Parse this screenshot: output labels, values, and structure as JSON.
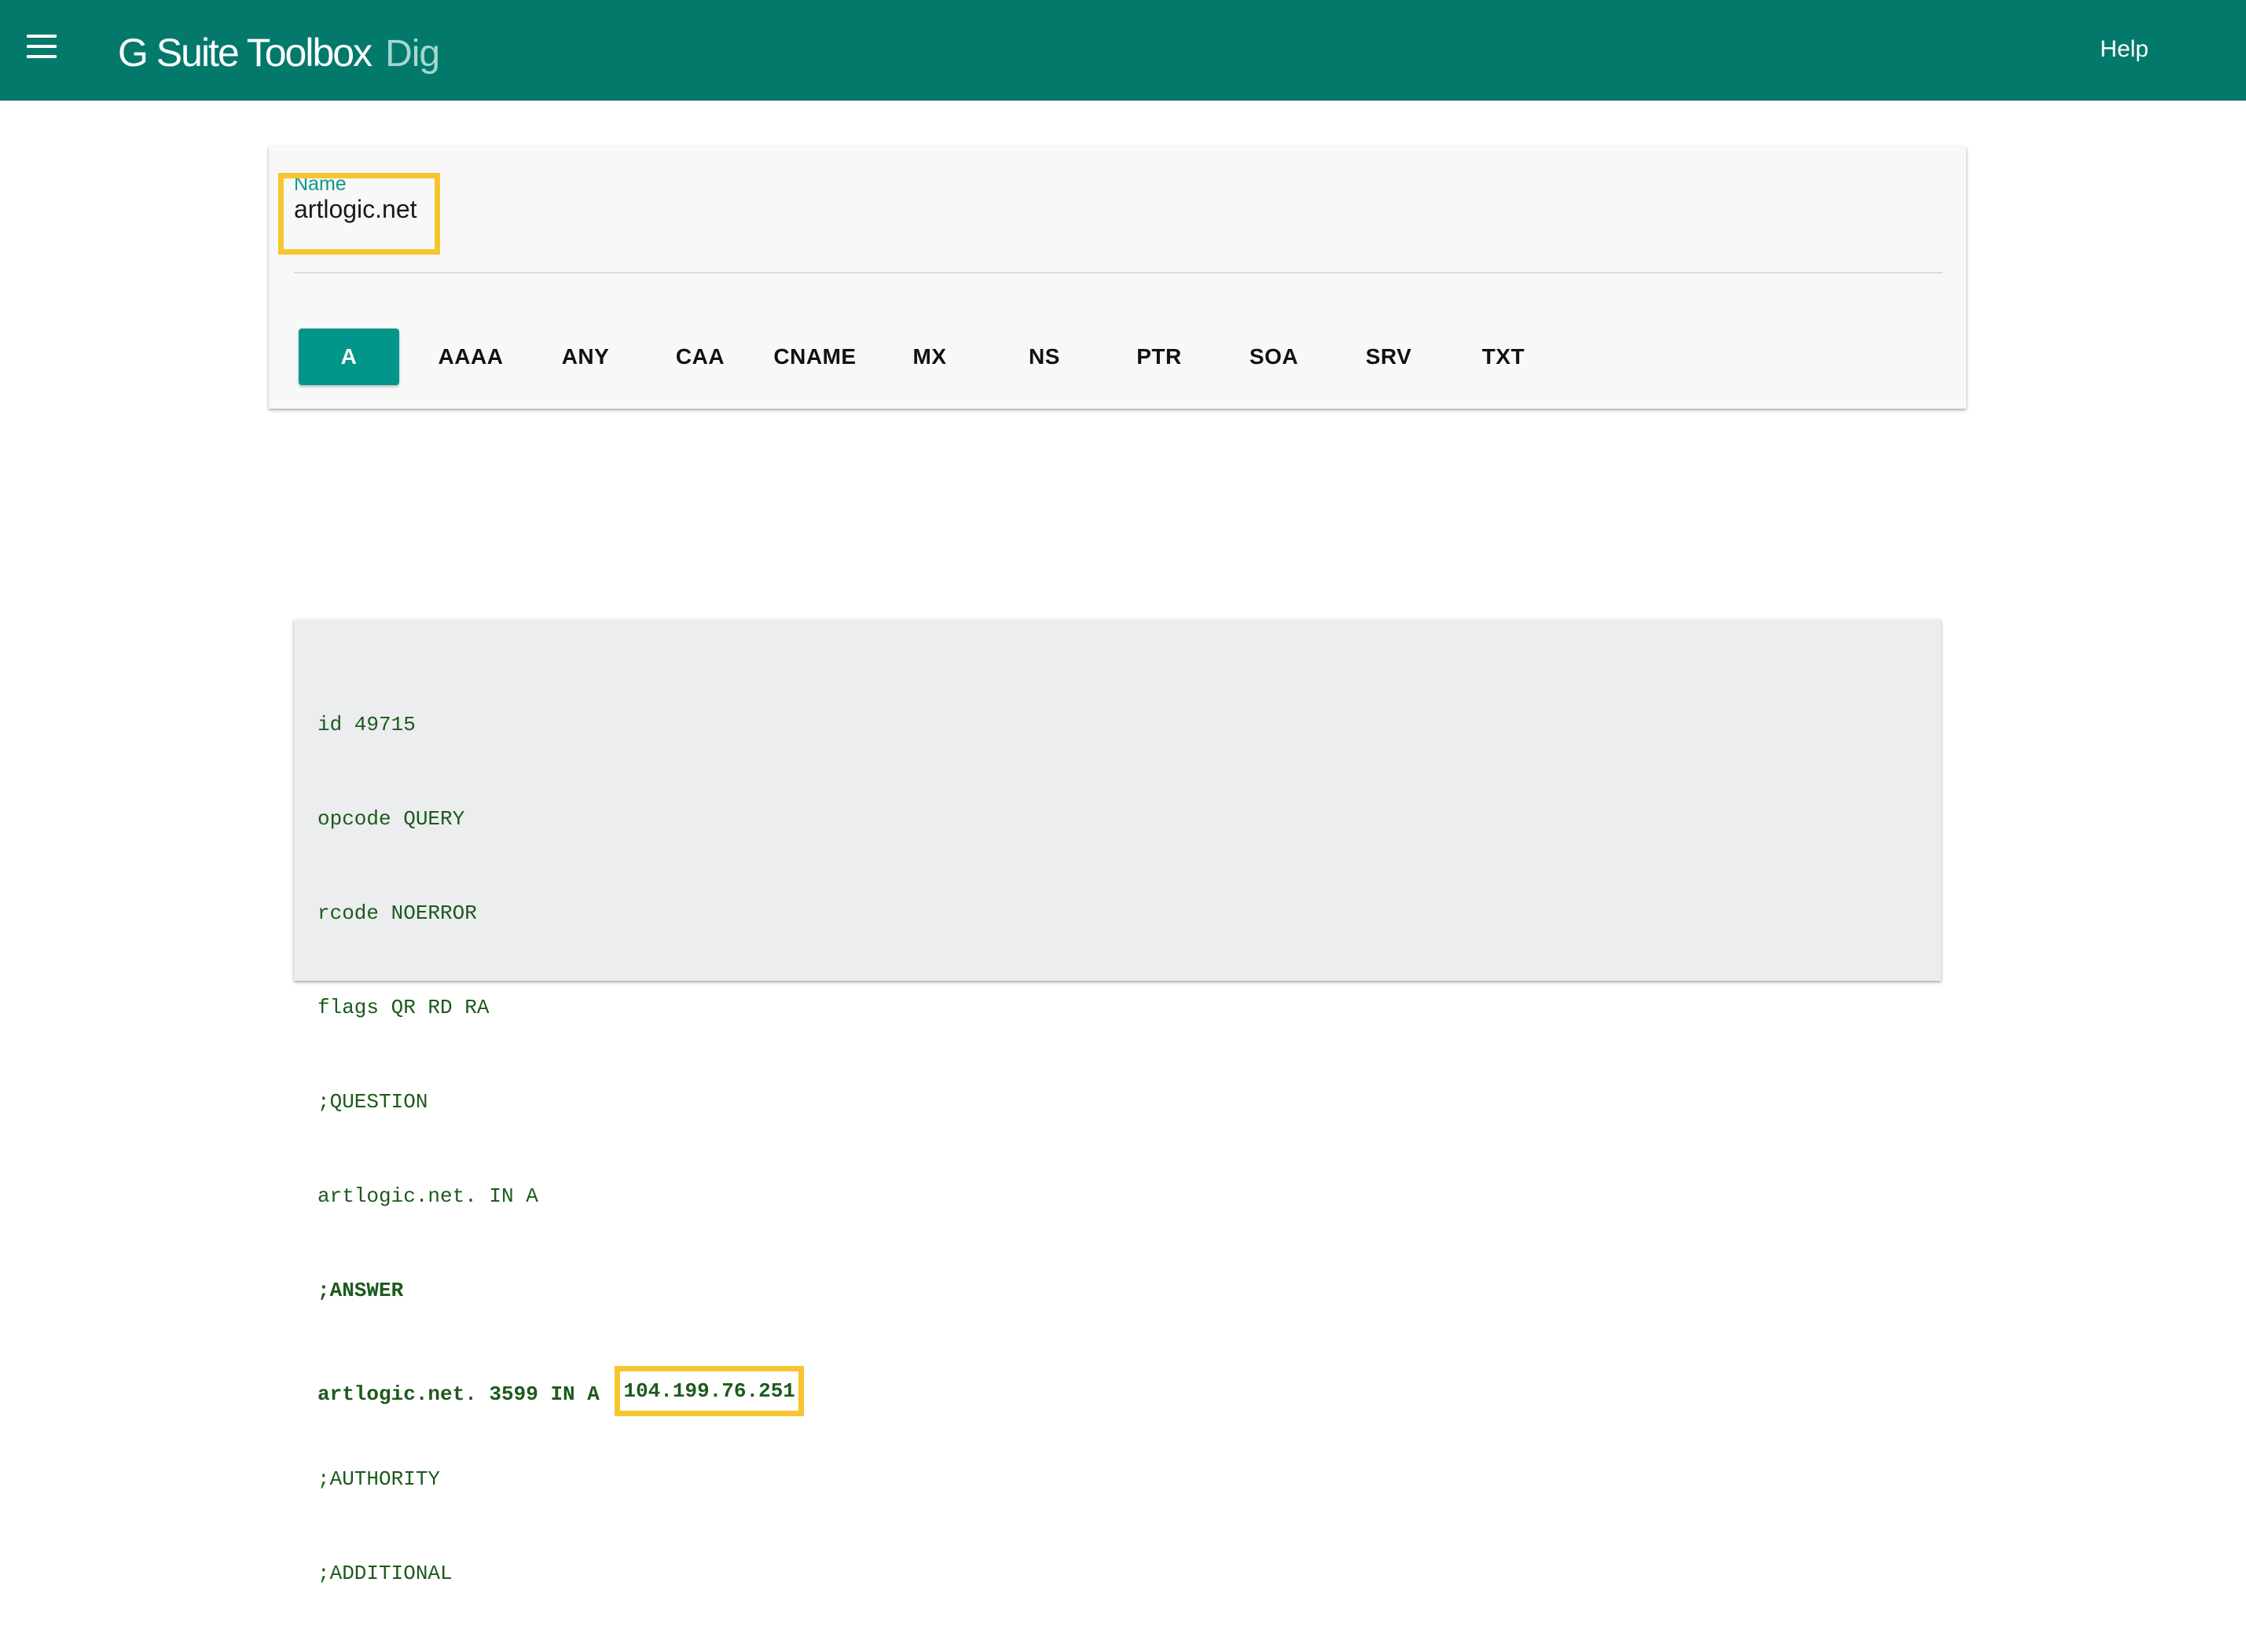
{
  "header": {
    "title": "G Suite Toolbox",
    "subtitle": "Dig",
    "help_label": "Help",
    "icons": {
      "menu": "hamburger-menu-icon"
    },
    "colors": {
      "bar": "#02796b",
      "accent": "#02968a",
      "highlight": "#f7c52f"
    }
  },
  "query": {
    "name_label": "Name",
    "name_value": "artlogic.net",
    "record_types": [
      "A",
      "AAAA",
      "ANY",
      "CAA",
      "CNAME",
      "MX",
      "NS",
      "PTR",
      "SOA",
      "SRV",
      "TXT"
    ],
    "selected_type": "A"
  },
  "result": {
    "lines": [
      {
        "text": "id 49715",
        "bold": false
      },
      {
        "text": "opcode QUERY",
        "bold": false
      },
      {
        "text": "rcode NOERROR",
        "bold": false
      },
      {
        "text": "flags QR RD RA",
        "bold": false
      },
      {
        "text": ";QUESTION",
        "bold": false
      },
      {
        "text": "artlogic.net. IN A",
        "bold": false
      },
      {
        "text": ";ANSWER",
        "bold": true
      },
      {
        "text": ";AUTHORITY",
        "bold": false
      },
      {
        "text": ";ADDITIONAL",
        "bold": false
      }
    ],
    "answer_prefix": "artlogic.net. 3599 IN A",
    "answer_ip": "104.199.76.251"
  }
}
